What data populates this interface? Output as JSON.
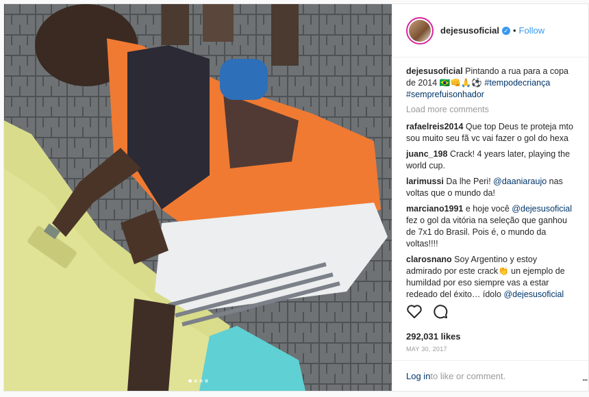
{
  "header": {
    "username": "dejesusoficial",
    "separator": "•",
    "follow_label": "Follow",
    "verified_glyph": "✓"
  },
  "caption": {
    "user": "dejesusoficial",
    "text": "Pintando a rua para a copa de 2014 🇧🇷👊🙏⚽",
    "tags": [
      "#tempodecriança",
      "#semprefuisonhador"
    ]
  },
  "load_more_label": "Load more comments",
  "comments": [
    {
      "user": "rafaelreis2014",
      "text": "Que top Deus te proteja mto sou muito seu fã vc vai fazer o gol do hexa"
    },
    {
      "user": "juanc_198",
      "text": "Crack! 4 years later, playing the world cup."
    },
    {
      "user": "larimussi",
      "text": "Da lhe Peri! ",
      "mention": "@daaniaraujo",
      "after": " nas voltas que o mundo da!"
    },
    {
      "user": "marciano1991",
      "text": "e hoje você ",
      "mention": "@dejesusoficial",
      "after": " fez o gol da vitória na seleção que ganhou de 7x1 do Brasil. Pois é, o mundo da voltas!!!!"
    },
    {
      "user": "clarosnano",
      "text": "Soy Argentino y estoy admirado por este crack👏 un ejemplo de humildad por eso siempre vas a estar redeado del éxito… ídolo ",
      "mention": "@dejesusoficial",
      "after": ""
    }
  ],
  "likes": "292,031 likes",
  "date": "MAY 30, 2017",
  "footer": {
    "login": "Log in",
    "rest": " to like or comment.",
    "more": "..."
  },
  "icons": {
    "heart": "heart-icon",
    "comment": "comment-icon"
  },
  "colors": {
    "link": "#003569",
    "follow": "#3897f0",
    "verified": "#3897f0"
  }
}
